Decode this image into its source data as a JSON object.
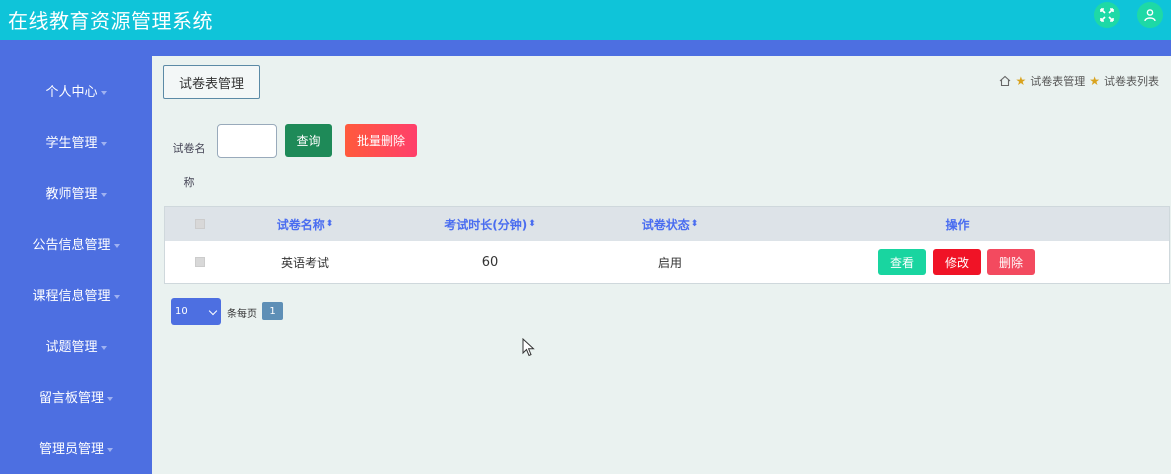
{
  "header": {
    "title": "在线教育资源管理系统",
    "icons": [
      "fullscreen-icon",
      "user-icon"
    ],
    "accent_color": "#0fc4d9"
  },
  "sidebar": {
    "background": "#4d6fe1",
    "items": [
      {
        "label": "个人中心"
      },
      {
        "label": "学生管理"
      },
      {
        "label": "教师管理"
      },
      {
        "label": "公告信息管理"
      },
      {
        "label": "课程信息管理"
      },
      {
        "label": "试题管理"
      },
      {
        "label": "留言板管理"
      },
      {
        "label": "管理员管理"
      }
    ]
  },
  "page": {
    "title": "试卷表管理",
    "breadcrumb": [
      "试卷表管理",
      "试卷表列表"
    ]
  },
  "search": {
    "label": "试卷名称",
    "value": "",
    "query_button": "查询",
    "batch_delete_button": "批量删除"
  },
  "table": {
    "headers": [
      "试卷名称",
      "考试时长(分钟)",
      "试卷状态",
      "操作"
    ],
    "rows": [
      {
        "name": "英语考试",
        "duration": "60",
        "status": "启用"
      }
    ],
    "actions": {
      "view": "查看",
      "edit": "修改",
      "delete": "删除"
    }
  },
  "pagination": {
    "page_size": "10",
    "page_size_label": "条每页",
    "current_page": "1"
  }
}
